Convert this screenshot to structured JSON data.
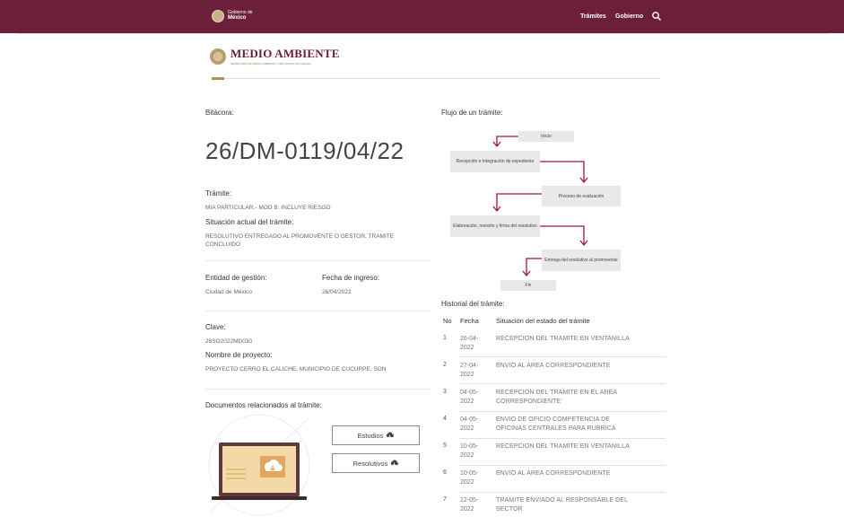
{
  "header": {
    "logo_small": "Gobierno de",
    "logo_big": "México",
    "nav": [
      "Trámites",
      "Gobierno"
    ],
    "search_icon": "search-icon",
    "bg_color": "#6b1f3a"
  },
  "brand": {
    "title": "MEDIO AMBIENTE",
    "subtitle": "SECRETARÍA DE MEDIO AMBIENTE Y RECURSOS NATURALES"
  },
  "bitacora": {
    "label": "Bitácora:",
    "value": "26/DM-0119/04/22"
  },
  "tramite": {
    "label": "Trámite:",
    "value": "MIA PARTICULAR.- MOD B: INCLUYE RIESGO"
  },
  "situacion": {
    "label": "Situación actual del trámite:",
    "value_line1": "RESOLUTIVO ENTREGADO AL PROMOVENTE O GESTOR, TRAMITE",
    "value_line2": "CONCLUIDO"
  },
  "entidad": {
    "label": "Entidad de gestión:",
    "value": "Ciudad de México"
  },
  "fecha_ingreso": {
    "label": "Fecha de ingreso:",
    "value": "26/04/2022"
  },
  "clave": {
    "label": "Clave:",
    "value": "26SO2022MD030"
  },
  "proyecto": {
    "label": "Nombre de proyecto:",
    "value": "PROYECTO CERRO EL CALICHE, MUNICIPIO DE CUCURPE, SON"
  },
  "documentos": {
    "label": "Documentos relacionados al trámite:",
    "estudios": "Estudios",
    "resolutivos": "Resolutivos",
    "download_icon": "download-cloud-icon"
  },
  "flujo": {
    "label": "Flujo de un trámite:",
    "steps": [
      "Inicio",
      "Recepción e Integración de expediente",
      "Proceso de evaluación",
      "Elaboración, revisión y firma del resolutivo",
      "Entrega del resolutivo al promovente",
      "Fin"
    ],
    "arrow_color": "#a0153e"
  },
  "historial": {
    "label": "Historial del trámite:",
    "columns": [
      "No",
      "Fecha",
      "Situación del estado del trámite"
    ],
    "rows": [
      {
        "no": "1",
        "fecha1": "26-04-",
        "fecha2": "2022",
        "sit1": "RECEPCION DEL TRAMITE EN VENTANILLA",
        "sit2": ""
      },
      {
        "no": "2",
        "fecha1": "27-04-",
        "fecha2": "2022",
        "sit1": "ENVIO AL AREA CORRESPONDIENTE",
        "sit2": ""
      },
      {
        "no": "3",
        "fecha1": "04-05-",
        "fecha2": "2022",
        "sit1": "RECEPCION DEL TRAMITE EN EL AREA",
        "sit2": "CORRESPONDIENTE"
      },
      {
        "no": "4",
        "fecha1": "04-05-",
        "fecha2": "2022",
        "sit1": "ENVIO DE OFICIO COMPETENCIA DE",
        "sit2": "OFICINAS CENTRALES PARA RUBRICA"
      },
      {
        "no": "5",
        "fecha1": "10-05-",
        "fecha2": "2022",
        "sit1": "RECEPCION DEL TRAMITE EN VENTANILLA",
        "sit2": ""
      },
      {
        "no": "6",
        "fecha1": "10-05-",
        "fecha2": "2022",
        "sit1": "ENVIO AL AREA CORRESPONDIENTE",
        "sit2": ""
      },
      {
        "no": "7",
        "fecha1": "12-05-",
        "fecha2": "2022",
        "sit1": "TRAMITE ENVIADO AL RESPONSABLE DEL",
        "sit2": "SECTOR"
      }
    ]
  }
}
